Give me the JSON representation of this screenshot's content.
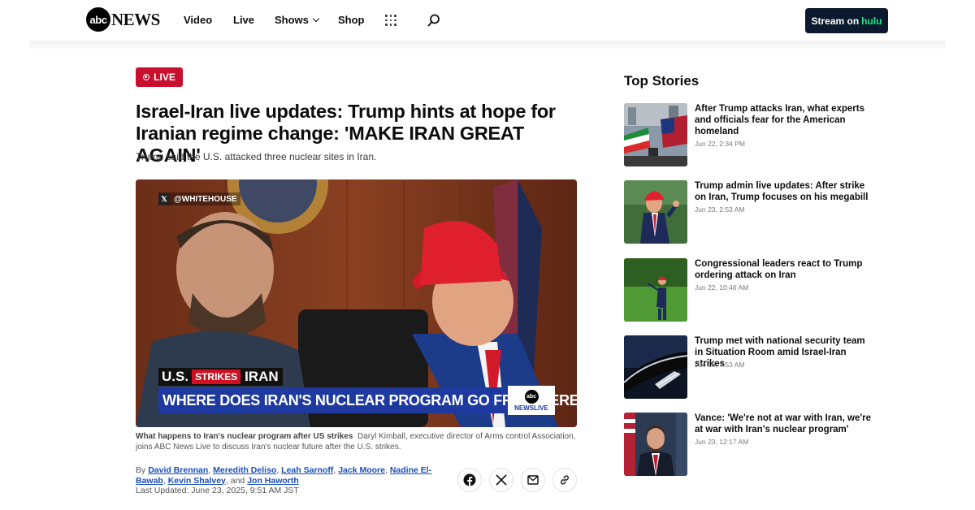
{
  "header": {
    "logo_badge": "abc",
    "logo_text": "NEWS",
    "nav": {
      "video": "Video",
      "live": "Live",
      "shows": "Shows",
      "shop": "Shop"
    },
    "stream_prefix": "Stream on",
    "stream_brand": "hulu"
  },
  "article": {
    "badge": "LIVE",
    "headline": "Israel-Iran live updates: Trump hints at hope for Iranian regime change: 'MAKE IRAN GREAT AGAIN'",
    "subhead": "Trump said the U.S. attacked three nuclear sites in Iran.",
    "video": {
      "source_handle": "@WHITEHOUSE",
      "lower_third_us": "U.S.",
      "lower_third_strikes": "STRIKES",
      "lower_third_iran": "IRAN",
      "lower_third_main": "WHERE DOES IRAN'S NUCLEAR PROGRAM GO FROM HERE?",
      "network_logo": "abc",
      "network_label": "NEWSLIVE"
    },
    "caption_title": "What happens to Iran's nuclear program after US strikes",
    "caption_body": "Daryl Kimball, executive director of Arms control Association, joins ABC News Live to discuss Iran's nuclear future after the U.S. strikes.",
    "byline_prefix": "By",
    "authors": [
      "David Brennan",
      "Meredith Deliso",
      "Leah Sarnoff",
      "Jack Moore",
      "Nadine El-Bawab",
      "Kevin Shalvey",
      "Jon Haworth"
    ],
    "byline_and": "and",
    "last_updated": "Last Updated: June 23, 2025, 9:51 AM JST"
  },
  "sidebar": {
    "heading": "Top Stories",
    "stories": [
      {
        "title": "After Trump attacks Iran, what experts and officials fear for the American homeland",
        "date": "Jun 22, 2:34 PM"
      },
      {
        "title": "Trump admin live updates: After strike on Iran, Trump focuses on his megabill",
        "date": "Jun 23, 2:53 AM"
      },
      {
        "title": "Congressional leaders react to Trump ordering attack on Iran",
        "date": "Jun 22, 10:46 AM"
      },
      {
        "title": "Trump met with national security team in Situation Room amid Israel-Iran strikes",
        "date": "Jun 18, 7:53 AM"
      },
      {
        "title": "Vance: 'We're not at war with Iran, we're at war with Iran's nuclear program'",
        "date": "Jun 23, 12:17 AM"
      }
    ]
  },
  "colors": {
    "live_red": "#c8102e",
    "link_blue": "#1a4fb5",
    "hulu_green": "#1ce783",
    "stream_bg": "#0b1a2e",
    "chyron_blue": "#1e3aa0"
  },
  "icons": [
    "grid-icon",
    "search-icon",
    "chevron-down-icon",
    "x-logo-icon",
    "facebook-icon",
    "x-share-icon",
    "email-icon",
    "link-icon"
  ]
}
